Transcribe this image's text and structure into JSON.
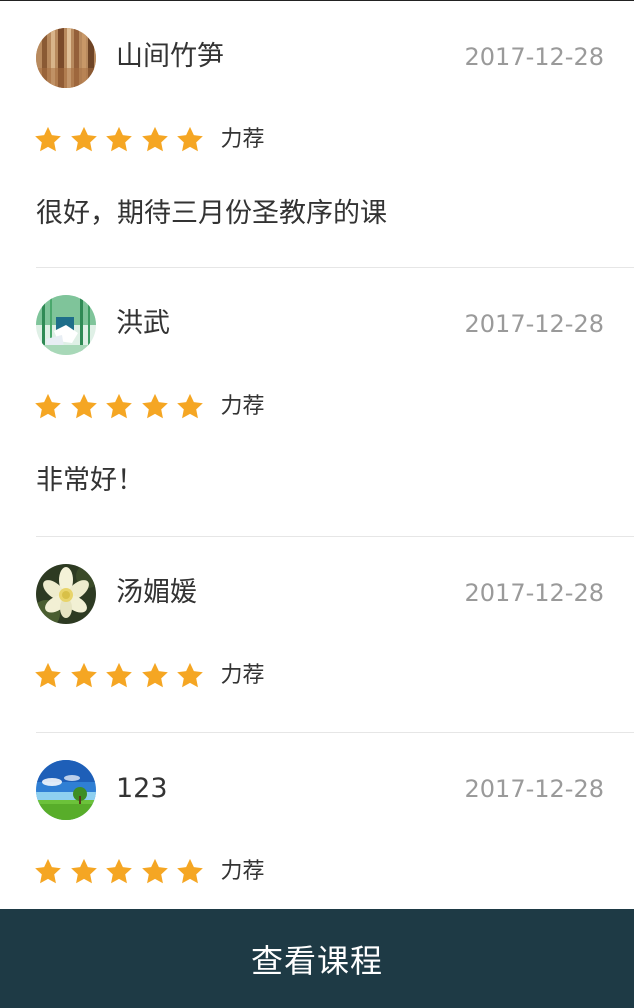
{
  "reviews": [
    {
      "username": "山间竹笋",
      "date": "2017-12-28",
      "rating": 5,
      "rating_max": 5,
      "rating_label": "力荐",
      "comment": "很好，期待三月份圣教序的课",
      "avatar": "bamboo-forest-avatar"
    },
    {
      "username": "洪武",
      "date": "2017-12-28",
      "rating": 5,
      "rating_max": 5,
      "rating_label": "力荐",
      "comment": "非常好！",
      "avatar": "bamboo-painting-avatar"
    },
    {
      "username": "汤媚媛",
      "date": "2017-12-28",
      "rating": 5,
      "rating_max": 5,
      "rating_label": "力荐",
      "comment": "",
      "avatar": "lotus-flower-avatar"
    },
    {
      "username": "123",
      "date": "2017-12-28",
      "rating": 5,
      "rating_max": 5,
      "rating_label": "力荐",
      "comment": "",
      "avatar": "landscape-avatar"
    }
  ],
  "footer": {
    "view_course_label": "查看课程"
  },
  "colors": {
    "star": "#f5a623",
    "footer_bg": "#1e3a45",
    "date_text": "#9a9a9a",
    "body_text": "#333333"
  }
}
